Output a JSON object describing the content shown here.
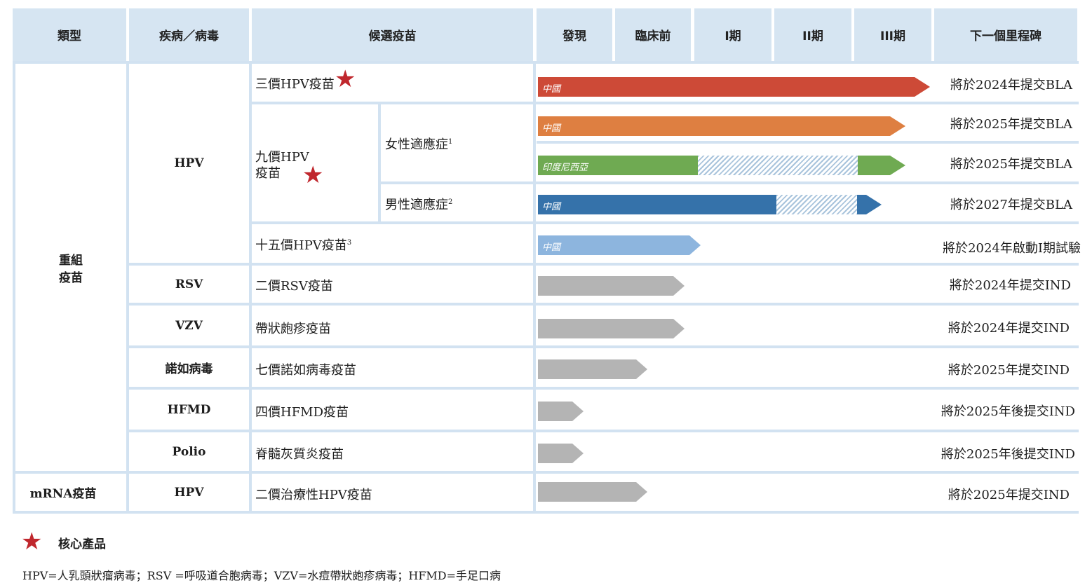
{
  "header": {
    "type": "類型",
    "disease": "疾病／病毒",
    "candidate": "候選疫苗",
    "discovery": "發現",
    "preclinical": "臨床前",
    "phase1": "I期",
    "phase2": "II期",
    "phase3": "III期",
    "milestone": "下一個里程碑"
  },
  "types": {
    "recombinant_line1": "重組",
    "recombinant_line2": "疫苗",
    "mrna": "mRNA疫苗"
  },
  "diseases": {
    "hpv": "HPV",
    "rsv": "RSV",
    "vzv": "VZV",
    "norovirus": "諾如病毒",
    "hfmd": "HFMD",
    "polio": "Polio",
    "hpv_mrna": "HPV"
  },
  "candidates": {
    "hpv3": "三價HPV疫苗",
    "hpv9_line1": "九價HPV",
    "hpv9_line2": "疫苗",
    "female": "女性適應症",
    "female_sup": "1",
    "male": "男性適應症",
    "male_sup": "2",
    "hpv15": "十五價HPV疫苗",
    "hpv15_sup": "3",
    "rsv2": "二價RSV疫苗",
    "zoster": "帶狀皰疹疫苗",
    "noro7": "七價諾如病毒疫苗",
    "hfmd4": "四價HFMD疫苗",
    "polio": "脊髓灰質炎疫苗",
    "therapeutic": "二價治療性HPV疫苗"
  },
  "bar_labels": {
    "hpv3": "中國",
    "hpv9_female_cn": "中國",
    "hpv9_female_id": "印度尼西亞",
    "hpv9_male": "中國",
    "hpv15": "中國"
  },
  "milestones": {
    "hpv3": "將於2024年提交BLA",
    "hpv9_female_cn": "將於2025年提交BLA",
    "hpv9_female_id": "將於2025年提交BLA",
    "hpv9_male": "將於2027年提交BLA",
    "hpv15": "將於2024年啟動I期試驗",
    "rsv2": "將於2024年提交IND",
    "zoster": "將於2024年提交IND",
    "noro7": "將於2025年提交IND",
    "hfmd4": "將於2025年後提交IND",
    "polio": "將於2025年後提交IND",
    "therapeutic": "將於2025年提交IND"
  },
  "legend": {
    "core": "核心產品"
  },
  "footnote": "HPV=人乳頭狀瘤病毒；RSV =呼吸道合胞病毒；VZV=水痘帶狀皰疹病毒；HFMD=手足口病",
  "colors": {
    "header_bg": "#d6e5f2",
    "grid": "#d2e2f1",
    "star": "#c0272d",
    "hpv3": "#cd4a37",
    "hpv9_cn": "#de7f41",
    "hpv9_id": "#6faa52",
    "hpv9_male": "#3572aa",
    "hpv15": "#8db5de",
    "preclinical": "#b4b4b4"
  }
}
